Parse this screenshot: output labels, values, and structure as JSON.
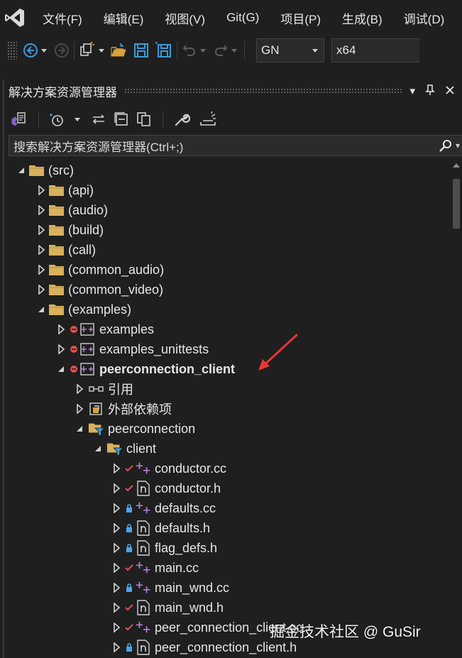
{
  "menu": [
    "文件(F)",
    "编辑(E)",
    "视图(V)",
    "Git(G)",
    "项目(P)",
    "生成(B)",
    "调试(D)"
  ],
  "toolbar": {
    "config": "GN",
    "platform": "x64"
  },
  "panel": {
    "title": "解决方案资源管理器",
    "search_placeholder": "搜索解决方案资源管理器(Ctrl+;)"
  },
  "tree": [
    {
      "label": "(src)",
      "depth": 0,
      "expanded": true,
      "icon": "folder-icon",
      "status": ""
    },
    {
      "label": "(api)",
      "depth": 1,
      "expanded": false,
      "icon": "folder-icon",
      "status": ""
    },
    {
      "label": "(audio)",
      "depth": 1,
      "expanded": false,
      "icon": "folder-icon",
      "status": ""
    },
    {
      "label": "(build)",
      "depth": 1,
      "expanded": false,
      "icon": "folder-icon",
      "status": ""
    },
    {
      "label": "(call)",
      "depth": 1,
      "expanded": false,
      "icon": "folder-icon",
      "status": ""
    },
    {
      "label": "(common_audio)",
      "depth": 1,
      "expanded": false,
      "icon": "folder-icon",
      "status": ""
    },
    {
      "label": "(common_video)",
      "depth": 1,
      "expanded": false,
      "icon": "folder-icon",
      "status": ""
    },
    {
      "label": "(examples)",
      "depth": 1,
      "expanded": true,
      "icon": "folder-icon",
      "status": ""
    },
    {
      "label": "examples",
      "depth": 2,
      "expanded": false,
      "icon": "cpp-project-icon",
      "status": "excluded"
    },
    {
      "label": "examples_unittests",
      "depth": 2,
      "expanded": false,
      "icon": "cpp-project-icon",
      "status": "excluded"
    },
    {
      "label": "peerconnection_client",
      "depth": 2,
      "expanded": true,
      "icon": "cpp-project-icon",
      "status": "excluded",
      "bold": true
    },
    {
      "label": "引用",
      "depth": 3,
      "expanded": false,
      "icon": "references-icon",
      "status": ""
    },
    {
      "label": "外部依赖项",
      "depth": 3,
      "expanded": false,
      "icon": "external-deps-icon",
      "status": ""
    },
    {
      "label": "peerconnection",
      "depth": 3,
      "expanded": true,
      "icon": "filter-folder-icon",
      "status": ""
    },
    {
      "label": "client",
      "depth": 4,
      "expanded": true,
      "icon": "filter-folder-icon",
      "status": ""
    },
    {
      "label": "conductor.cc",
      "depth": 5,
      "expanded": false,
      "icon": "cpp-source-icon",
      "status": "modified"
    },
    {
      "label": "conductor.h",
      "depth": 5,
      "expanded": false,
      "icon": "header-file-icon",
      "status": "modified"
    },
    {
      "label": "defaults.cc",
      "depth": 5,
      "expanded": false,
      "icon": "cpp-source-icon",
      "status": "locked"
    },
    {
      "label": "defaults.h",
      "depth": 5,
      "expanded": false,
      "icon": "header-file-icon",
      "status": "locked"
    },
    {
      "label": "flag_defs.h",
      "depth": 5,
      "expanded": false,
      "icon": "header-file-icon",
      "status": "locked"
    },
    {
      "label": "main.cc",
      "depth": 5,
      "expanded": false,
      "icon": "cpp-source-icon",
      "status": "modified"
    },
    {
      "label": "main_wnd.cc",
      "depth": 5,
      "expanded": false,
      "icon": "cpp-source-icon",
      "status": "locked"
    },
    {
      "label": "main_wnd.h",
      "depth": 5,
      "expanded": false,
      "icon": "header-file-icon",
      "status": "modified"
    },
    {
      "label": "peer_connection_client.cc",
      "depth": 5,
      "expanded": false,
      "icon": "cpp-source-icon",
      "status": "modified"
    },
    {
      "label": "peer_connection_client.h",
      "depth": 5,
      "expanded": false,
      "icon": "header-file-icon",
      "status": "locked"
    }
  ],
  "colors": {
    "modified": "#e05252",
    "locked": "#4aa3e8",
    "excluded": "#e05252",
    "folder": "#d8b15c",
    "cpp": "#b27fd6",
    "accent": "#3c9ad8"
  },
  "watermark": "掘金技术社区 @ GuSir"
}
